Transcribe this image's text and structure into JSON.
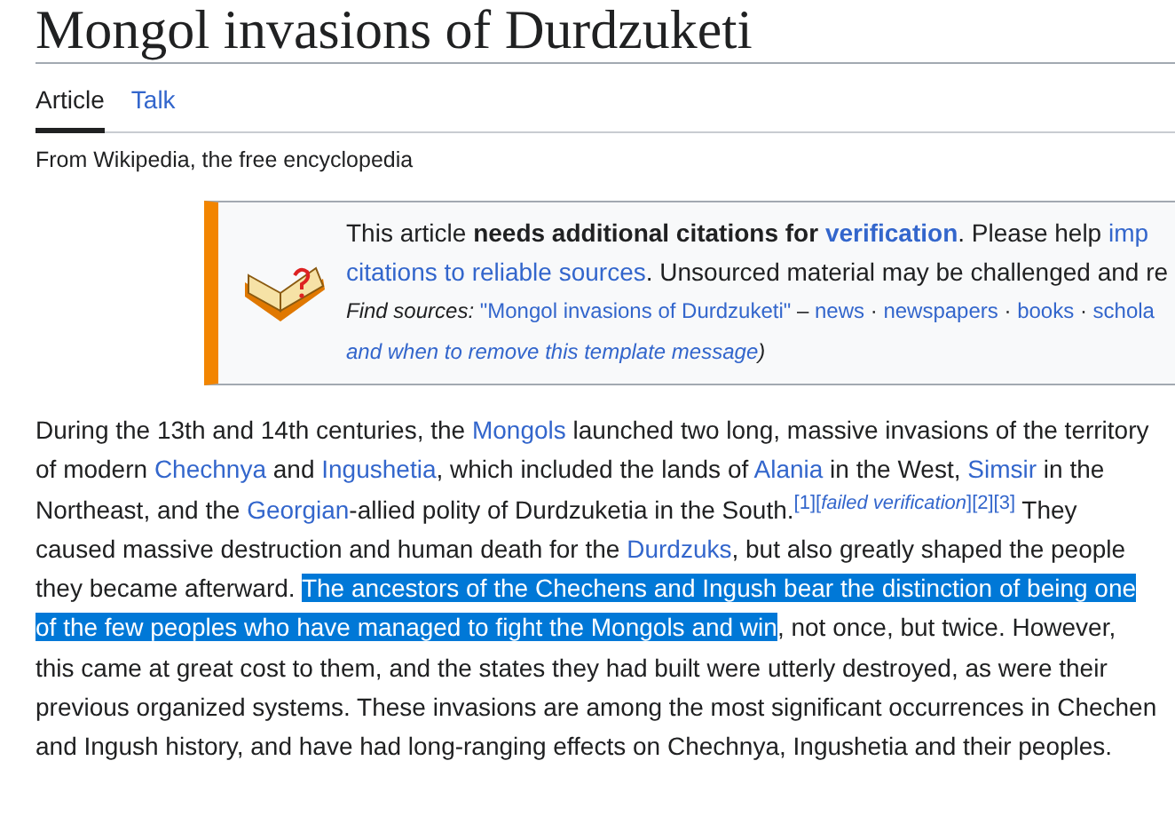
{
  "title": "Mongol invasions of Durdzuketi",
  "tabs": [
    {
      "label": "Article",
      "selected": true
    },
    {
      "label": "Talk",
      "selected": false
    }
  ],
  "tagline": "From Wikipedia, the free encyclopedia",
  "notice": {
    "lines": [
      [
        {
          "kind": "text",
          "text": "This article "
        },
        {
          "kind": "bold",
          "text": "needs additional citations for "
        },
        {
          "kind": "boldlink",
          "text": "verification"
        },
        {
          "kind": "text",
          "text": ". Please help "
        },
        {
          "kind": "link",
          "text": "imp"
        }
      ],
      [
        {
          "kind": "link",
          "text": "citations to reliable sources"
        },
        {
          "kind": "text",
          "text": ". Unsourced material may be challenged and re"
        }
      ],
      [
        {
          "kind": "italic",
          "text": "Find sources: "
        },
        {
          "kind": "link",
          "text": "\"Mongol invasions of Durdzuketi\""
        },
        {
          "kind": "text",
          "text": " – "
        },
        {
          "kind": "link",
          "text": "news"
        },
        {
          "kind": "text",
          "text": " · "
        },
        {
          "kind": "link",
          "text": "newspapers"
        },
        {
          "kind": "text",
          "text": " · "
        },
        {
          "kind": "link",
          "text": "books"
        },
        {
          "kind": "text",
          "text": " · "
        },
        {
          "kind": "link",
          "text": "schola"
        }
      ],
      [
        {
          "kind": "italiclink",
          "text": "and when to remove this template message"
        },
        {
          "kind": "italic",
          "text": ")"
        }
      ]
    ]
  },
  "paragraph": [
    {
      "kind": "text",
      "text": "During the 13th and 14th centuries, the "
    },
    {
      "kind": "link",
      "text": "Mongols"
    },
    {
      "kind": "text",
      "text": " launched two long, massive invasions of the territory of modern "
    },
    {
      "kind": "link",
      "text": "Chechnya"
    },
    {
      "kind": "text",
      "text": " and "
    },
    {
      "kind": "link",
      "text": "Ingushetia"
    },
    {
      "kind": "text",
      "text": ", which included the lands of "
    },
    {
      "kind": "link",
      "text": "Alania"
    },
    {
      "kind": "text",
      "text": " in the West, "
    },
    {
      "kind": "link",
      "text": "Simsir"
    },
    {
      "kind": "text",
      "text": " in the Northeast, and the "
    },
    {
      "kind": "link",
      "text": "Georgian"
    },
    {
      "kind": "text",
      "text": "-allied polity of Durdzuketia in the South."
    },
    {
      "kind": "ref",
      "text": "[1]"
    },
    {
      "kind": "ref",
      "text": "[*failed verification*]"
    },
    {
      "kind": "ref",
      "text": "[2]"
    },
    {
      "kind": "ref",
      "text": "[3]"
    },
    {
      "kind": "text",
      "text": " They caused massive destruction and human death for the "
    },
    {
      "kind": "link",
      "text": "Durdzuks"
    },
    {
      "kind": "text",
      "text": ", but also greatly shaped the people they became afterward. "
    },
    {
      "kind": "highlight",
      "text": "The ancestors of the Chechens and Ingush bear the distinction of being one of the few peoples who have managed to fight the Mongols and win"
    },
    {
      "kind": "text",
      "text": ", not once, but twice. However, this came at great cost to them, and the states they had built were utterly destroyed, as were their previous organized systems. These invasions are among the most significant occurrences in Chechen and Ingush history, and have had long-ranging effects on Chechnya, Ingushetia and their peoples."
    }
  ]
}
